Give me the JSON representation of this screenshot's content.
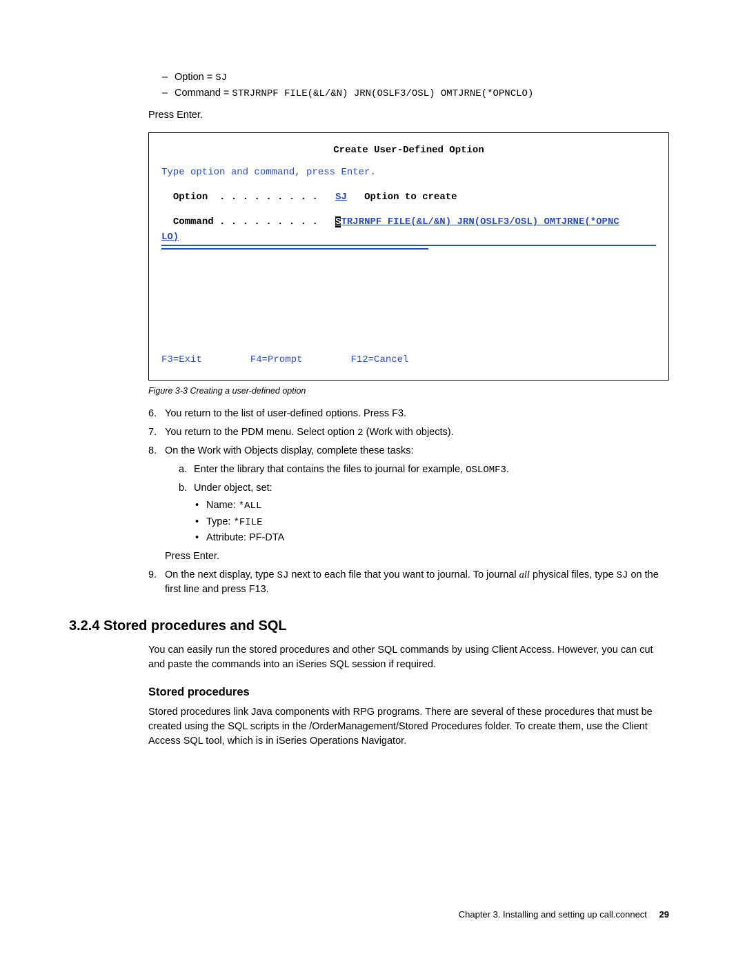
{
  "dash1_pre": "Option = ",
  "dash1_code": "SJ",
  "dash2_pre": "Command = ",
  "dash2_code": "STRJRNPF FILE(&L/&N) JRN(OSLF3/OSL) OMTJRNE(*OPNCLO)",
  "press_enter": "Press Enter.",
  "terminal": {
    "title": "Create User-Defined Option",
    "instr": "Type option and command, press Enter.",
    "opt_label": "Option  . . . . . . . . .",
    "opt_val": "SJ",
    "opt_desc": "Option to create",
    "cmd_label": "Command . . . . . . . . .",
    "cmd_cursor": "S",
    "cmd_rest": "TRJRNPF FILE(&L/&N) JRN(OSLF3/OSL) OMTJRNE(*OPNC",
    "cmd_wrap": "LO)",
    "f3": "F3=Exit",
    "f4": "F4=Prompt",
    "f12": "F12=Cancel"
  },
  "figcap": "Figure 3-3   Creating a user-defined option",
  "step6": "You return to the list of user-defined options. Press F3.",
  "step7_a": "You return to the PDM menu. Select option ",
  "step7_code": "2",
  "step7_b": " (Work with objects).",
  "step8": "On the Work with Objects display, complete these tasks:",
  "s8a_a": "Enter the library that contains the files to journal for example, ",
  "s8a_code": "OSLOMF3",
  "s8a_b": ".",
  "s8b": "Under object, set:",
  "b1_a": "Name: ",
  "b1_code": "*ALL",
  "b2_a": "Type: ",
  "b2_code": "*FILE",
  "b3": "Attribute: PF-DTA",
  "s8_press": "Press Enter.",
  "step9_a": "On the next display, type ",
  "step9_code1": "SJ",
  "step9_b": " next to each file that you want to journal. To journal ",
  "step9_all": "all",
  "step9_c": " physical files, type ",
  "step9_code2": "SJ",
  "step9_d": " on the first line and press F13.",
  "h2": "3.2.4  Stored procedures and SQL",
  "h2para": "You can easily run the stored procedures and other SQL commands by using Client Access. However, you can cut and paste the commands into an iSeries SQL session if required.",
  "h3": "Stored procedures",
  "h3para": "Stored procedures link Java components with RPG programs. There are several of these procedures that must be created using the SQL scripts in the /OrderManagement/Stored Procedures folder. To create them, use the Client Access SQL tool, which is in iSeries Operations Navigator.",
  "footer_chap": "Chapter 3. Installing and setting up call.connect",
  "footer_page": "29"
}
